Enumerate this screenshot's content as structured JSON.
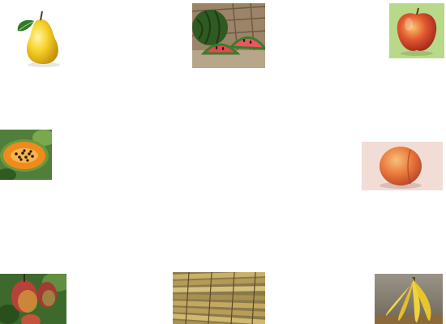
{
  "tiles": [
    {
      "id": "pear",
      "icon": "pear-icon"
    },
    {
      "id": "watermelon",
      "icon": "watermelon-icon"
    },
    {
      "id": "apple",
      "icon": "apple-icon"
    },
    {
      "id": "papaya",
      "icon": "papaya-icon"
    },
    {
      "id": "peach",
      "icon": "peach-icon"
    },
    {
      "id": "mango",
      "icon": "mango-icon"
    },
    {
      "id": "sugarcane",
      "icon": "sugarcane-icon"
    },
    {
      "id": "banana",
      "icon": "banana-icon"
    }
  ],
  "colors": {
    "background": "#ffffff",
    "pear": "#f2c519",
    "watermelon_rind": "#2f5a22",
    "watermelon_flesh": "#e8464f",
    "apple": "#d9482b",
    "apple_bg": "#b9d98a",
    "papaya": "#f08a1c",
    "peach": "#e8763a",
    "mango": "#b6423a",
    "sugarcane": "#c9b06a",
    "banana": "#f0cf34"
  }
}
